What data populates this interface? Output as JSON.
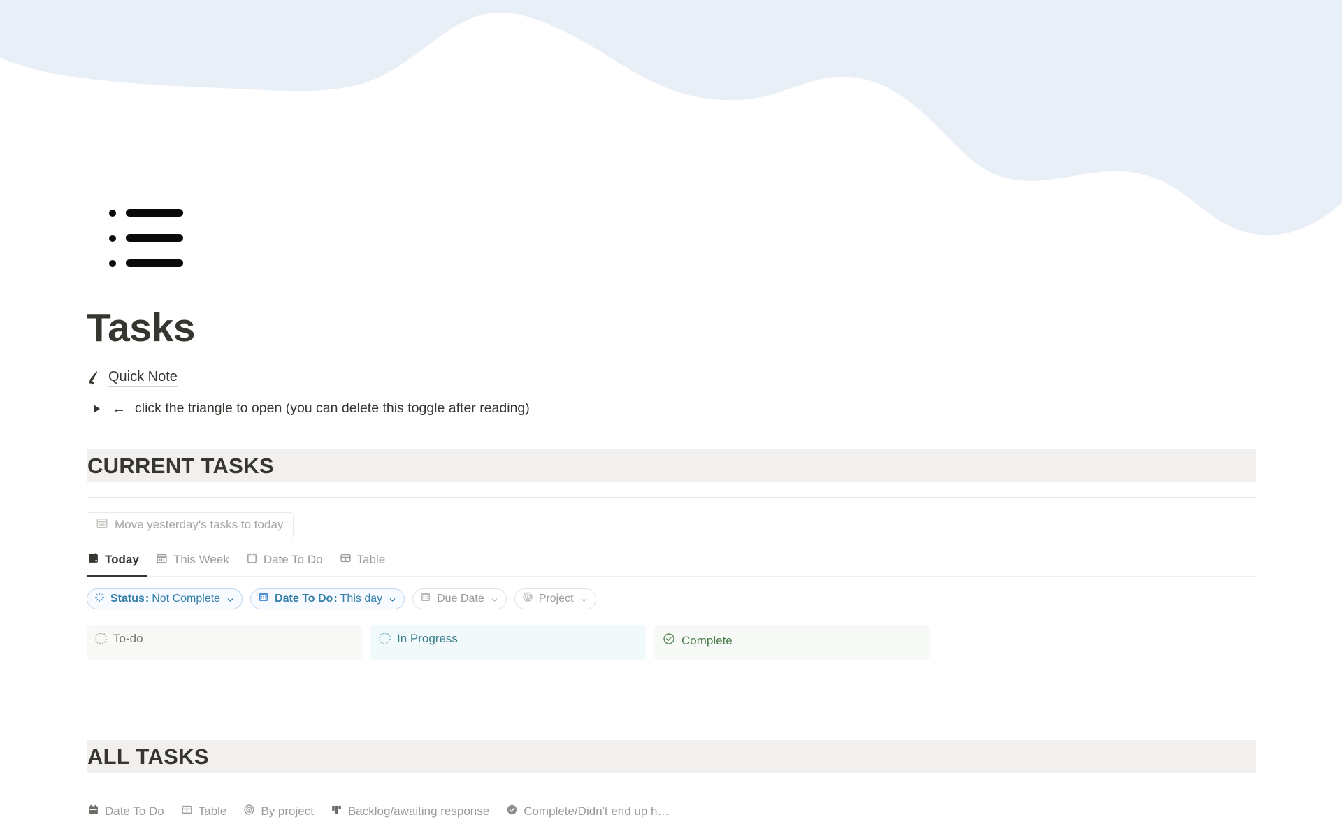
{
  "cover": {
    "color": "#e9eff6"
  },
  "page": {
    "icon_name": "bulleted-list-icon",
    "title": "Tasks"
  },
  "quick_note": {
    "icon": "pen-write-icon",
    "label": "Quick Note"
  },
  "toggle": {
    "arrow": "←",
    "text": "click the triangle to open (you can delete this toggle after reading)"
  },
  "current_tasks": {
    "heading": "CURRENT TASKS",
    "button": {
      "icon": "calendar-icon",
      "label": "Move yesterday's tasks to today"
    },
    "tabs": [
      {
        "label": "Today",
        "icon": "calendar-day-icon",
        "active": true
      },
      {
        "label": "This Week",
        "icon": "calendar-week-icon",
        "active": false
      },
      {
        "label": "Date To Do",
        "icon": "calendar-icon",
        "active": false
      },
      {
        "label": "Table",
        "icon": "table-icon",
        "active": false
      }
    ],
    "filters": [
      {
        "key": "Status",
        "value": "Not Complete",
        "icon": "loading-spinner-icon",
        "active": true
      },
      {
        "key": "Date To Do",
        "value": "This day",
        "icon": "calendar-grid-icon",
        "active": true
      },
      {
        "key": "Due Date",
        "value": "",
        "icon": "calendar-grid-icon",
        "active": false
      },
      {
        "key": "Project",
        "value": "",
        "icon": "target-icon",
        "active": false
      }
    ],
    "columns": [
      {
        "label": "To-do",
        "icon": "dashed-circle-icon",
        "color": "#787774"
      },
      {
        "label": "In Progress",
        "icon": "dashed-circle-icon",
        "color": "#3a7d8c"
      },
      {
        "label": "Complete",
        "icon": "check-circle-icon",
        "color": "#4b7d4b"
      }
    ]
  },
  "all_tasks": {
    "heading": "ALL TASKS",
    "tabs": [
      {
        "label": "Date To Do",
        "icon": "calendar-icon",
        "active": false
      },
      {
        "label": "Table",
        "icon": "table-icon",
        "active": false
      },
      {
        "label": "By project",
        "icon": "target-icon",
        "active": false
      },
      {
        "label": "Backlog/awaiting response",
        "icon": "board-icon",
        "active": false
      },
      {
        "label": "Complete/Didn't end up h…",
        "icon": "check-filled-icon",
        "active": false
      }
    ]
  }
}
